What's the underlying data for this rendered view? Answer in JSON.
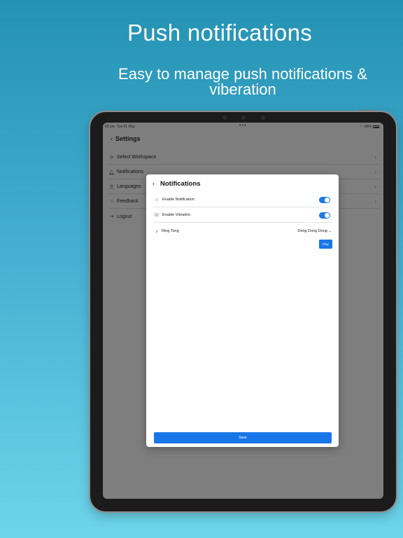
{
  "headline": "Push notifications",
  "subheadline": "Easy to manage push notifications & viberation",
  "status_bar": {
    "time": "05 pm",
    "date": "Tue 31 May",
    "battery": "66%"
  },
  "settings": {
    "title": "Settings",
    "items": [
      {
        "label": "Select Workspace",
        "icon": "switch-icon"
      },
      {
        "label": "Notifications",
        "icon": "bell-icon"
      },
      {
        "label": "Languages",
        "icon": "translate-icon"
      },
      {
        "label": "Feedback",
        "icon": "headphones-icon"
      },
      {
        "label": "Logout",
        "icon": "logout-icon"
      }
    ]
  },
  "modal": {
    "title": "Notifications",
    "enable_notification": {
      "label": "Enable Notification",
      "icon": "smile-icon",
      "on": true
    },
    "enable_vibration": {
      "label": "Enable Vibration",
      "icon": "vibration-icon",
      "on": true
    },
    "ring_tone": {
      "label": "Ring Tong",
      "icon": "music-note-icon",
      "value": "Dong Dong Dong"
    },
    "play_label": "Play",
    "save_label": "Save"
  },
  "colors": {
    "accent": "#1976e8",
    "bg_top": "#2492b3",
    "bg_bottom": "#6dd4ea"
  }
}
